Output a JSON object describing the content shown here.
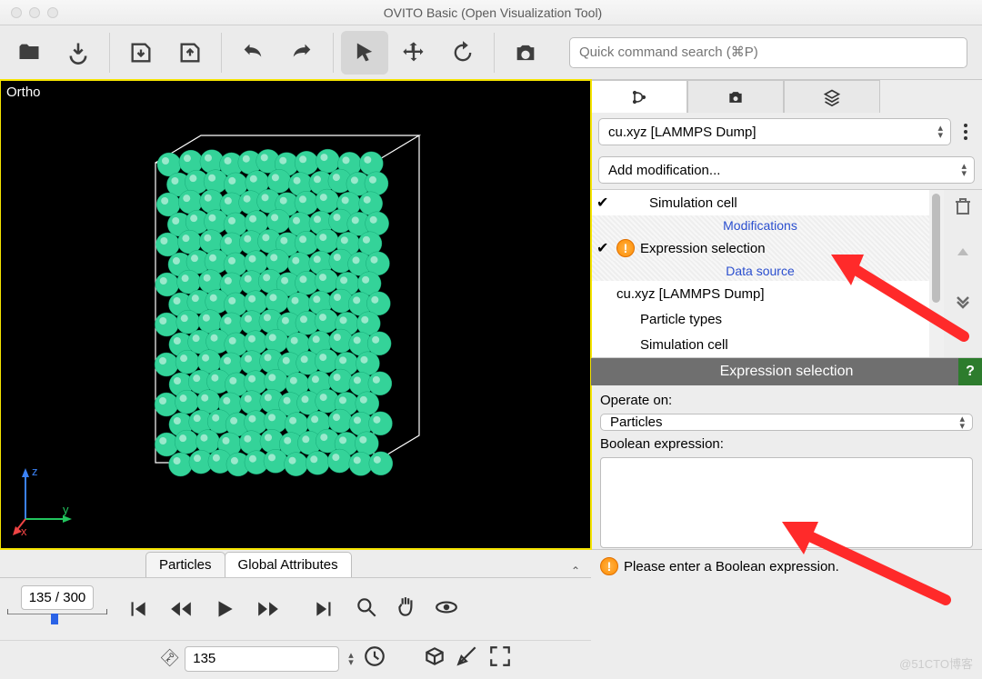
{
  "app": {
    "title": "OVITO Basic (Open Visualization Tool)"
  },
  "toolbar": {
    "search_placeholder": "Quick command search (⌘P)"
  },
  "viewport": {
    "label": "Ortho",
    "axes": {
      "x": "x",
      "y": "y",
      "z": "z"
    }
  },
  "pipeline": {
    "file": "cu.xyz [LAMMPS Dump]",
    "add_modification": "Add modification...",
    "items": [
      {
        "checked": true,
        "label": "Simulation cell",
        "type": "entry"
      },
      {
        "label": "Modifications",
        "type": "section"
      },
      {
        "checked": true,
        "label": "Expression selection",
        "type": "entry",
        "warn": true,
        "selected": true
      },
      {
        "label": "Data source",
        "type": "section",
        "selected": true
      },
      {
        "label": "cu.xyz [LAMMPS Dump]",
        "type": "entry"
      },
      {
        "label": "Particle types",
        "type": "subentry"
      },
      {
        "label": "Simulation cell",
        "type": "subentry"
      }
    ]
  },
  "properties": {
    "title": "Expression selection",
    "operate_on_label": "Operate on:",
    "operate_on_value": "Particles",
    "boolean_label": "Boolean expression:",
    "boolean_value": "",
    "warning": "Please enter a Boolean expression."
  },
  "tabs": {
    "particles": "Particles",
    "global": "Global Attributes"
  },
  "timeline": {
    "counter": "135 / 300",
    "frame_value": "135"
  },
  "watermark": "@51CTO博客"
}
